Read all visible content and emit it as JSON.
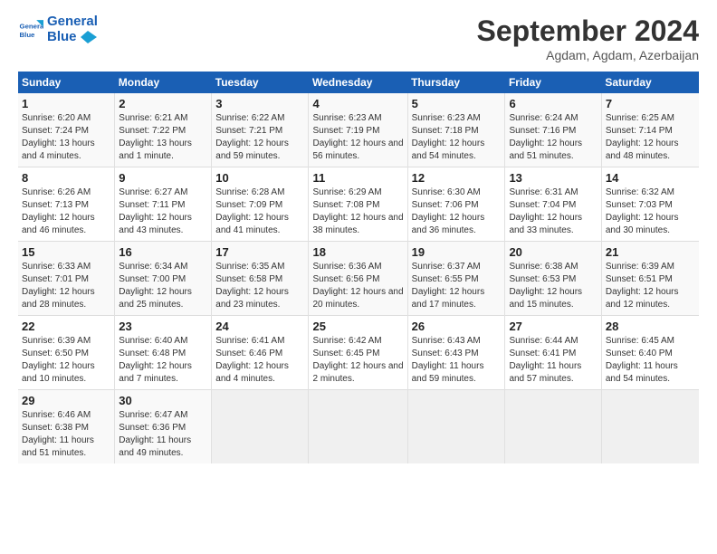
{
  "header": {
    "logo_line1": "General",
    "logo_line2": "Blue",
    "month": "September 2024",
    "location": "Agdam, Agdam, Azerbaijan"
  },
  "days_of_week": [
    "Sunday",
    "Monday",
    "Tuesday",
    "Wednesday",
    "Thursday",
    "Friday",
    "Saturday"
  ],
  "weeks": [
    [
      {
        "day": "1",
        "sunrise": "6:20 AM",
        "sunset": "7:24 PM",
        "daylight": "13 hours and 4 minutes."
      },
      {
        "day": "2",
        "sunrise": "6:21 AM",
        "sunset": "7:22 PM",
        "daylight": "13 hours and 1 minute."
      },
      {
        "day": "3",
        "sunrise": "6:22 AM",
        "sunset": "7:21 PM",
        "daylight": "12 hours and 59 minutes."
      },
      {
        "day": "4",
        "sunrise": "6:23 AM",
        "sunset": "7:19 PM",
        "daylight": "12 hours and 56 minutes."
      },
      {
        "day": "5",
        "sunrise": "6:23 AM",
        "sunset": "7:18 PM",
        "daylight": "12 hours and 54 minutes."
      },
      {
        "day": "6",
        "sunrise": "6:24 AM",
        "sunset": "7:16 PM",
        "daylight": "12 hours and 51 minutes."
      },
      {
        "day": "7",
        "sunrise": "6:25 AM",
        "sunset": "7:14 PM",
        "daylight": "12 hours and 48 minutes."
      }
    ],
    [
      {
        "day": "8",
        "sunrise": "6:26 AM",
        "sunset": "7:13 PM",
        "daylight": "12 hours and 46 minutes."
      },
      {
        "day": "9",
        "sunrise": "6:27 AM",
        "sunset": "7:11 PM",
        "daylight": "12 hours and 43 minutes."
      },
      {
        "day": "10",
        "sunrise": "6:28 AM",
        "sunset": "7:09 PM",
        "daylight": "12 hours and 41 minutes."
      },
      {
        "day": "11",
        "sunrise": "6:29 AM",
        "sunset": "7:08 PM",
        "daylight": "12 hours and 38 minutes."
      },
      {
        "day": "12",
        "sunrise": "6:30 AM",
        "sunset": "7:06 PM",
        "daylight": "12 hours and 36 minutes."
      },
      {
        "day": "13",
        "sunrise": "6:31 AM",
        "sunset": "7:04 PM",
        "daylight": "12 hours and 33 minutes."
      },
      {
        "day": "14",
        "sunrise": "6:32 AM",
        "sunset": "7:03 PM",
        "daylight": "12 hours and 30 minutes."
      }
    ],
    [
      {
        "day": "15",
        "sunrise": "6:33 AM",
        "sunset": "7:01 PM",
        "daylight": "12 hours and 28 minutes."
      },
      {
        "day": "16",
        "sunrise": "6:34 AM",
        "sunset": "7:00 PM",
        "daylight": "12 hours and 25 minutes."
      },
      {
        "day": "17",
        "sunrise": "6:35 AM",
        "sunset": "6:58 PM",
        "daylight": "12 hours and 23 minutes."
      },
      {
        "day": "18",
        "sunrise": "6:36 AM",
        "sunset": "6:56 PM",
        "daylight": "12 hours and 20 minutes."
      },
      {
        "day": "19",
        "sunrise": "6:37 AM",
        "sunset": "6:55 PM",
        "daylight": "12 hours and 17 minutes."
      },
      {
        "day": "20",
        "sunrise": "6:38 AM",
        "sunset": "6:53 PM",
        "daylight": "12 hours and 15 minutes."
      },
      {
        "day": "21",
        "sunrise": "6:39 AM",
        "sunset": "6:51 PM",
        "daylight": "12 hours and 12 minutes."
      }
    ],
    [
      {
        "day": "22",
        "sunrise": "6:39 AM",
        "sunset": "6:50 PM",
        "daylight": "12 hours and 10 minutes."
      },
      {
        "day": "23",
        "sunrise": "6:40 AM",
        "sunset": "6:48 PM",
        "daylight": "12 hours and 7 minutes."
      },
      {
        "day": "24",
        "sunrise": "6:41 AM",
        "sunset": "6:46 PM",
        "daylight": "12 hours and 4 minutes."
      },
      {
        "day": "25",
        "sunrise": "6:42 AM",
        "sunset": "6:45 PM",
        "daylight": "12 hours and 2 minutes."
      },
      {
        "day": "26",
        "sunrise": "6:43 AM",
        "sunset": "6:43 PM",
        "daylight": "11 hours and 59 minutes."
      },
      {
        "day": "27",
        "sunrise": "6:44 AM",
        "sunset": "6:41 PM",
        "daylight": "11 hours and 57 minutes."
      },
      {
        "day": "28",
        "sunrise": "6:45 AM",
        "sunset": "6:40 PM",
        "daylight": "11 hours and 54 minutes."
      }
    ],
    [
      {
        "day": "29",
        "sunrise": "6:46 AM",
        "sunset": "6:38 PM",
        "daylight": "11 hours and 51 minutes."
      },
      {
        "day": "30",
        "sunrise": "6:47 AM",
        "sunset": "6:36 PM",
        "daylight": "11 hours and 49 minutes."
      },
      null,
      null,
      null,
      null,
      null
    ]
  ],
  "labels": {
    "sunrise": "Sunrise:",
    "sunset": "Sunset:",
    "daylight": "Daylight:"
  }
}
